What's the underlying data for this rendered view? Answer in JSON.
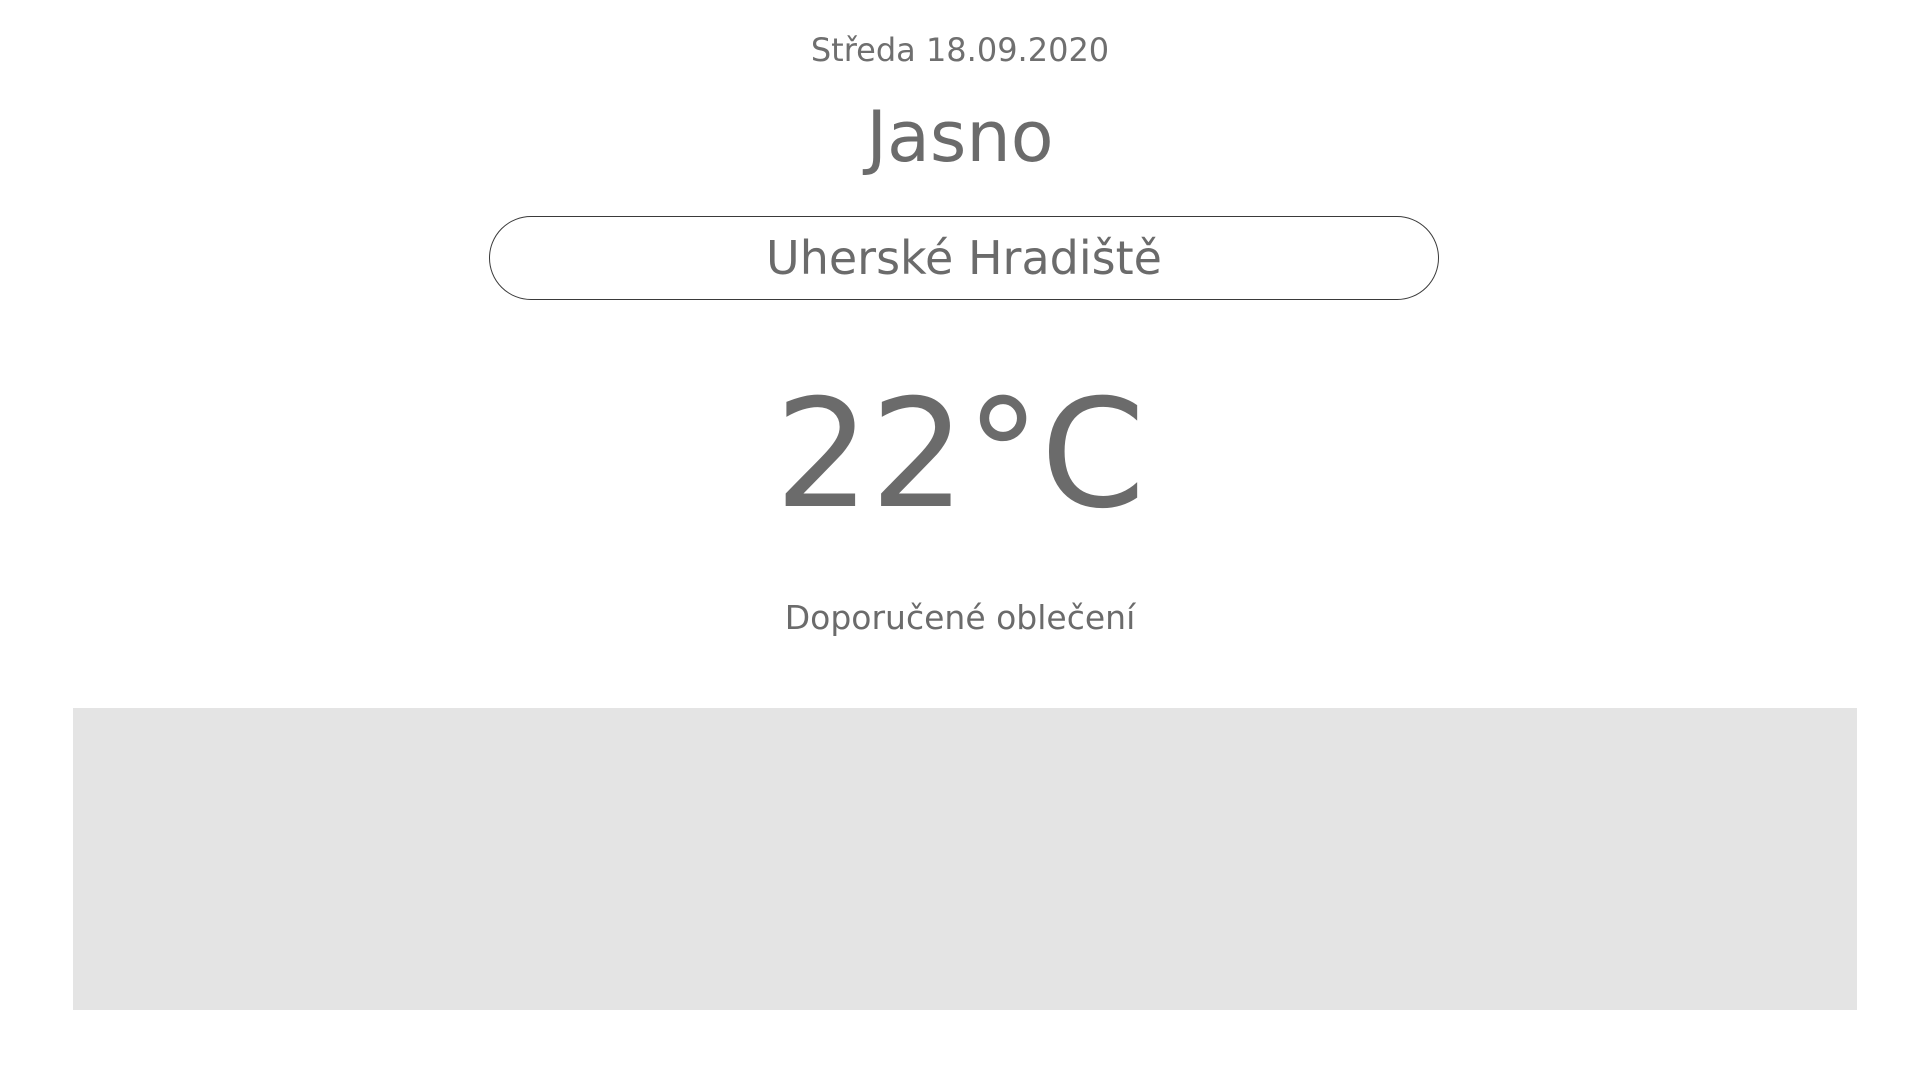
{
  "date": "Středa 18.09.2020",
  "condition": "Jasno",
  "city_input": {
    "value": "Uherské Hradiště"
  },
  "temperature": "22°C",
  "clothes_label": "Doporučené oblečení",
  "colors": {
    "text": "#6b6b6b",
    "panel_background": "#e4e4e4",
    "field_border": "#3a3a3a",
    "background": "#ffffff"
  }
}
